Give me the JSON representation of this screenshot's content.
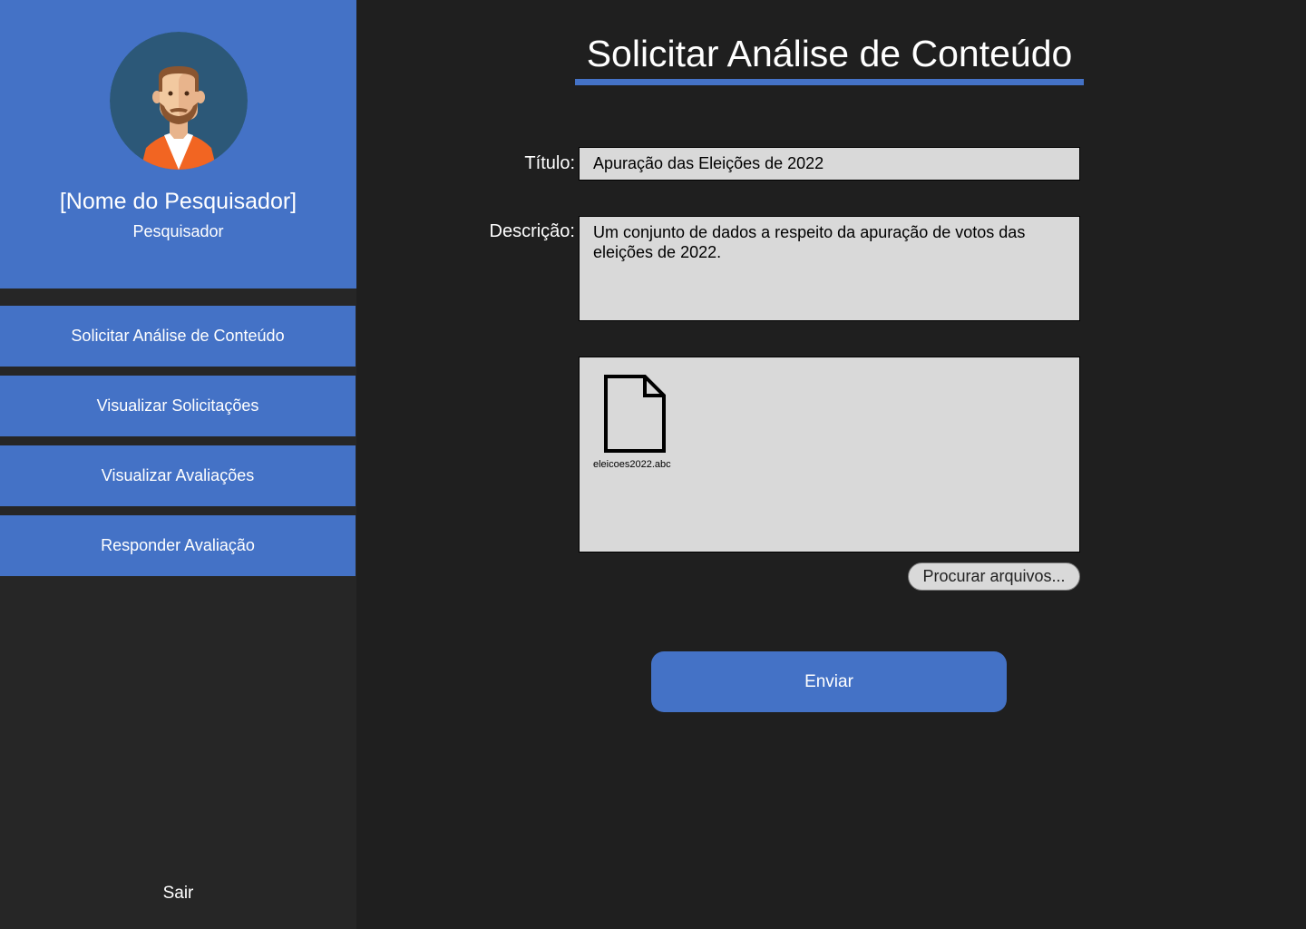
{
  "sidebar": {
    "profile": {
      "name": "[Nome do Pesquisador]",
      "role": "Pesquisador",
      "avatar_icon": "person-avatar-icon"
    },
    "nav": [
      {
        "label": "Solicitar Análise de Conteúdo"
      },
      {
        "label": "Visualizar Solicitações"
      },
      {
        "label": "Visualizar Avaliações"
      },
      {
        "label": "Responder Avaliação"
      }
    ],
    "logout_label": "Sair"
  },
  "main": {
    "title": "Solicitar Análise de Conteúdo",
    "form": {
      "title_label": "Título:",
      "title_value": "Apuração das Eleições de 2022",
      "description_label": "Descrição:",
      "description_value": "Um conjunto de dados a respeito da apuração de votos das eleições de 2022.",
      "files": [
        {
          "name": "eleicoes2022.abc",
          "icon": "file-icon"
        }
      ],
      "browse_label": "Procurar arquivos...",
      "submit_label": "Enviar"
    }
  },
  "colors": {
    "accent": "#4472c6",
    "background": "#1f1f1f",
    "sidebar": "#262626",
    "input": "#d9d9d9"
  }
}
